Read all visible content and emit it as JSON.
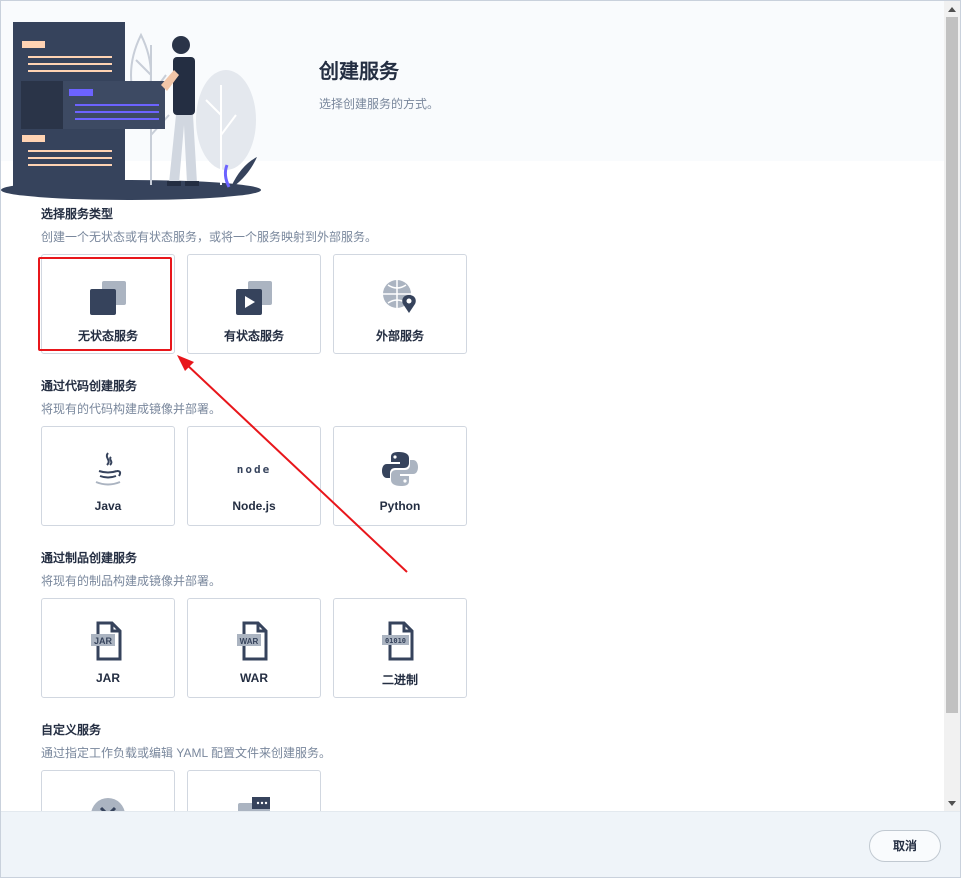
{
  "header": {
    "title": "创建服务",
    "description": "选择创建服务的方式。"
  },
  "sections": [
    {
      "title": "选择服务类型",
      "description": "创建一个无状态或有状态服务，或将一个服务映射到外部服务。",
      "cards": [
        {
          "label": "无状态服务",
          "icon": "stateless-service-icon"
        },
        {
          "label": "有状态服务",
          "icon": "stateful-service-icon"
        },
        {
          "label": "外部服务",
          "icon": "external-service-icon"
        }
      ]
    },
    {
      "title": "通过代码创建服务",
      "description": "将现有的代码构建成镜像并部署。",
      "cards": [
        {
          "label": "Java",
          "icon": "java-icon"
        },
        {
          "label": "Node.js",
          "icon": "nodejs-icon"
        },
        {
          "label": "Python",
          "icon": "python-icon"
        }
      ]
    },
    {
      "title": "通过制品创建服务",
      "description": "将现有的制品构建成镜像并部署。",
      "cards": [
        {
          "label": "JAR",
          "icon": "jar-file-icon"
        },
        {
          "label": "WAR",
          "icon": "war-file-icon"
        },
        {
          "label": "二进制",
          "icon": "binary-file-icon"
        }
      ]
    },
    {
      "title": "自定义服务",
      "description": "通过指定工作负载或编辑 YAML 配置文件来创建服务。",
      "cards": [
        {
          "label": "",
          "icon": "workload-icon"
        },
        {
          "label": "",
          "icon": "yaml-editor-icon"
        }
      ]
    }
  ],
  "icon_text": {
    "node": "node",
    "jar": "JAR",
    "war": "WAR",
    "binary": "01010"
  },
  "footer": {
    "cancel_label": "取消"
  },
  "colors": {
    "accent_dark": "#36435c",
    "icon_gray": "#abb4c1",
    "highlight_red": "#e8161b",
    "illustration_purple": "#6c63ff",
    "illustration_peach": "#ffd3b3"
  }
}
